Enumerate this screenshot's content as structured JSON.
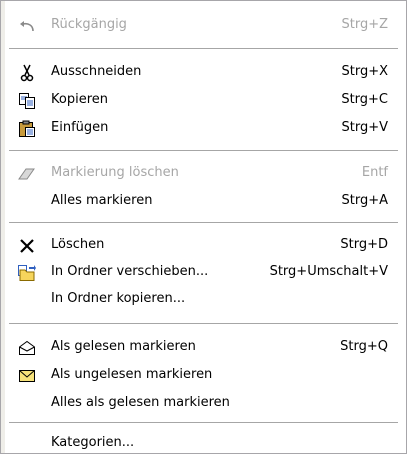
{
  "menu": {
    "items": [
      {
        "label": "Rückgängig",
        "shortcut": "Strg+Z",
        "icon": "undo-icon",
        "disabled": true
      },
      {
        "label": "Ausschneiden",
        "shortcut": "Strg+X",
        "icon": "scissors-icon",
        "disabled": false
      },
      {
        "label": "Kopieren",
        "shortcut": "Strg+C",
        "icon": "copy-icon",
        "disabled": false
      },
      {
        "label": "Einfügen",
        "shortcut": "Strg+V",
        "icon": "paste-icon",
        "disabled": false
      },
      {
        "label": "Markierung löschen",
        "shortcut": "Entf",
        "icon": "eraser-icon",
        "disabled": true
      },
      {
        "label": "Alles markieren",
        "shortcut": "Strg+A",
        "icon": "",
        "disabled": false
      },
      {
        "label": "Löschen",
        "shortcut": "Strg+D",
        "icon": "delete-x-icon",
        "disabled": false
      },
      {
        "label": "In Ordner verschieben...",
        "shortcut": "Strg+Umschalt+V",
        "icon": "move-to-folder-icon",
        "disabled": false
      },
      {
        "label": "In Ordner kopieren...",
        "shortcut": "",
        "icon": "",
        "disabled": false
      },
      {
        "label": "Als gelesen markieren",
        "shortcut": "Strg+Q",
        "icon": "open-envelope-icon",
        "disabled": false
      },
      {
        "label": "Als ungelesen markieren",
        "shortcut": "",
        "icon": "closed-envelope-icon",
        "disabled": false
      },
      {
        "label": "Alles als gelesen markieren",
        "shortcut": "",
        "icon": "",
        "disabled": false
      },
      {
        "label": "Kategorien...",
        "shortcut": "",
        "icon": "",
        "disabled": false
      }
    ]
  },
  "colors": {
    "disabled_text": "#a6a6a6",
    "separator": "#a6a6a6",
    "border": "#a7a6aa"
  }
}
